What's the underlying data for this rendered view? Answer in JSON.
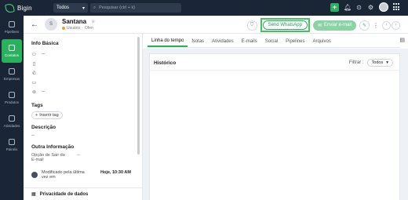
{
  "topbar": {
    "app_name": "Bigin",
    "module_select": "Todos",
    "search_placeholder": "Pesquisar (ctrl + k)",
    "add_icon": "+"
  },
  "leftnav": {
    "items": [
      {
        "label": "Pipelines",
        "icon": "pipelines-icon",
        "active": false
      },
      {
        "label": "Contatos",
        "icon": "contacts-icon",
        "active": true
      },
      {
        "label": "Empresas",
        "icon": "companies-icon",
        "active": false
      },
      {
        "label": "Produtos",
        "icon": "products-icon",
        "active": false
      },
      {
        "label": "Atividades",
        "icon": "activities-icon",
        "active": false
      },
      {
        "label": "Painéis",
        "icon": "dashboards-icon",
        "active": false
      }
    ]
  },
  "record": {
    "avatar_initial": "S",
    "name": "Santana",
    "sub_role": "Usuário",
    "sub_status": "Ofen",
    "whatsapp_label": "Send WhatsApp",
    "email_label": "Enviar e-mail"
  },
  "details": {
    "basic_title": "Info Básica",
    "fields": [
      {
        "icon": "person-icon",
        "value": "--"
      },
      {
        "icon": "mobile-icon",
        "value": ""
      },
      {
        "icon": "phone-icon",
        "value": ""
      },
      {
        "icon": "card-icon",
        "value": ""
      },
      {
        "icon": "location-icon",
        "value": "--"
      }
    ],
    "tags_title": "Tags",
    "add_tag_label": "Inserir tag",
    "description_title": "Descrição",
    "description_value": "--",
    "other_title": "Outra Informação",
    "optout_label": "Opção de Sair do E-mail",
    "optout_value": "--",
    "modified_label": "Modificado pela última vez em",
    "modified_date": "Hoje, 10:30 AM",
    "privacy_label": "Privacidade de dados"
  },
  "tabs": [
    "Linha do tempo",
    "Notas",
    "Atividades",
    "E-mails",
    "Social",
    "Pipelines",
    "Arquivos"
  ],
  "history": {
    "title": "Histórico",
    "filter_label": "Filtrar :",
    "filter_value": "Todos"
  },
  "colors": {
    "topbar_bg": "#1a2635",
    "accent_green": "#29b25e",
    "highlight_border": "#3ec55e"
  }
}
